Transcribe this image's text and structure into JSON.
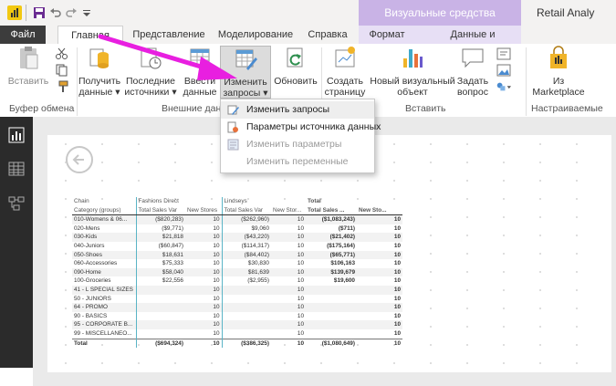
{
  "titlebar": {
    "contextual_group": "Визуальные средства",
    "app_title": "Retail Analy"
  },
  "tabs": [
    {
      "id": "file",
      "label": "Файл"
    },
    {
      "id": "home",
      "label": "Главная"
    },
    {
      "id": "view",
      "label": "Представление"
    },
    {
      "id": "modeling",
      "label": "Моделирование"
    },
    {
      "id": "help",
      "label": "Справка"
    },
    {
      "id": "format",
      "label": "Формат"
    },
    {
      "id": "data",
      "label": "Данные и детализация"
    }
  ],
  "ribbon": {
    "paste": "Вставить",
    "get_data": [
      "Получить",
      "данные ▾"
    ],
    "recent_sources": [
      "Последние",
      "источники ▾"
    ],
    "enter_data": [
      "Ввести",
      "данные"
    ],
    "edit_queries": [
      "Изменить",
      "запросы ▾"
    ],
    "refresh": "Обновить",
    "new_page": [
      "Создать",
      "страницу ▾"
    ],
    "new_visual": [
      "Новый визуальный",
      "объект"
    ],
    "ask_question": [
      "Задать",
      "вопрос"
    ],
    "marketplace": [
      "Из",
      "Marketplace"
    ],
    "groups": {
      "clipboard": "Буфер обмена",
      "external_data": "Внешние данн",
      "insert": "Вставить",
      "custom": "Настраиваемые"
    }
  },
  "dropdown": {
    "items": [
      {
        "label": "Изменить запросы",
        "enabled": true,
        "icon": "edit-query-icon"
      },
      {
        "label": "Параметры источника данных",
        "enabled": true,
        "icon": "datasource-settings-icon"
      },
      {
        "label": "Изменить параметры",
        "enabled": false,
        "icon": "edit-parameters-icon"
      },
      {
        "label": "Изменить переменные",
        "enabled": false,
        "icon": "edit-variables-icon"
      }
    ]
  },
  "matrix": {
    "header1": [
      "Chain",
      "Fashions Direct",
      "",
      "Lindseys",
      "",
      "Total",
      ""
    ],
    "header2": [
      "Category (groups)",
      "Total Sales Var",
      "New Stores",
      "Total Sales Var",
      "New Stor...",
      "Total Sales ...",
      "New Sto..."
    ],
    "rows": [
      [
        "010-Womens & 06...",
        "($820,283)",
        "10",
        "($262,960)",
        "10",
        "($1,083,243)",
        "10"
      ],
      [
        "020-Mens",
        "($9,771)",
        "10",
        "$9,060",
        "10",
        "($711)",
        "10"
      ],
      [
        "030-Kids",
        "$21,818",
        "10",
        "($43,220)",
        "10",
        "($21,402)",
        "10"
      ],
      [
        "040-Juniors",
        "($60,847)",
        "10",
        "($114,317)",
        "10",
        "($175,164)",
        "10"
      ],
      [
        "050-Shoes",
        "$18,631",
        "10",
        "($84,402)",
        "10",
        "($65,771)",
        "10"
      ],
      [
        "060-Accessories",
        "$75,333",
        "10",
        "$30,830",
        "10",
        "$106,163",
        "10"
      ],
      [
        "090-Home",
        "$58,040",
        "10",
        "$81,639",
        "10",
        "$139,679",
        "10"
      ],
      [
        "100-Groceries",
        "$22,556",
        "10",
        "($2,955)",
        "10",
        "$19,600",
        "10"
      ],
      [
        "41 - L SPECIAL SIZES",
        "",
        "10",
        "",
        "10",
        "",
        "10"
      ],
      [
        "50 - JUNIORS",
        "",
        "10",
        "",
        "10",
        "",
        "10"
      ],
      [
        "64 - PROMO",
        "",
        "10",
        "",
        "10",
        "",
        "10"
      ],
      [
        "90 - BASICS",
        "",
        "10",
        "",
        "10",
        "",
        "10"
      ],
      [
        "95 - CORPORATE B...",
        "",
        "10",
        "",
        "10",
        "",
        "10"
      ],
      [
        "99 - MISCELLANEO...",
        "",
        "10",
        "",
        "10",
        "",
        "10"
      ]
    ],
    "total": [
      "Total",
      "($694,324)",
      "10",
      "($386,325)",
      "10",
      "($1,080,649)",
      "10"
    ]
  },
  "colors": {
    "contextual_purple": "#c9b3e6",
    "arrow_magenta": "#e81fe0",
    "file_tab": "#3c3c3c",
    "column_separator": "#5ab4c6"
  }
}
